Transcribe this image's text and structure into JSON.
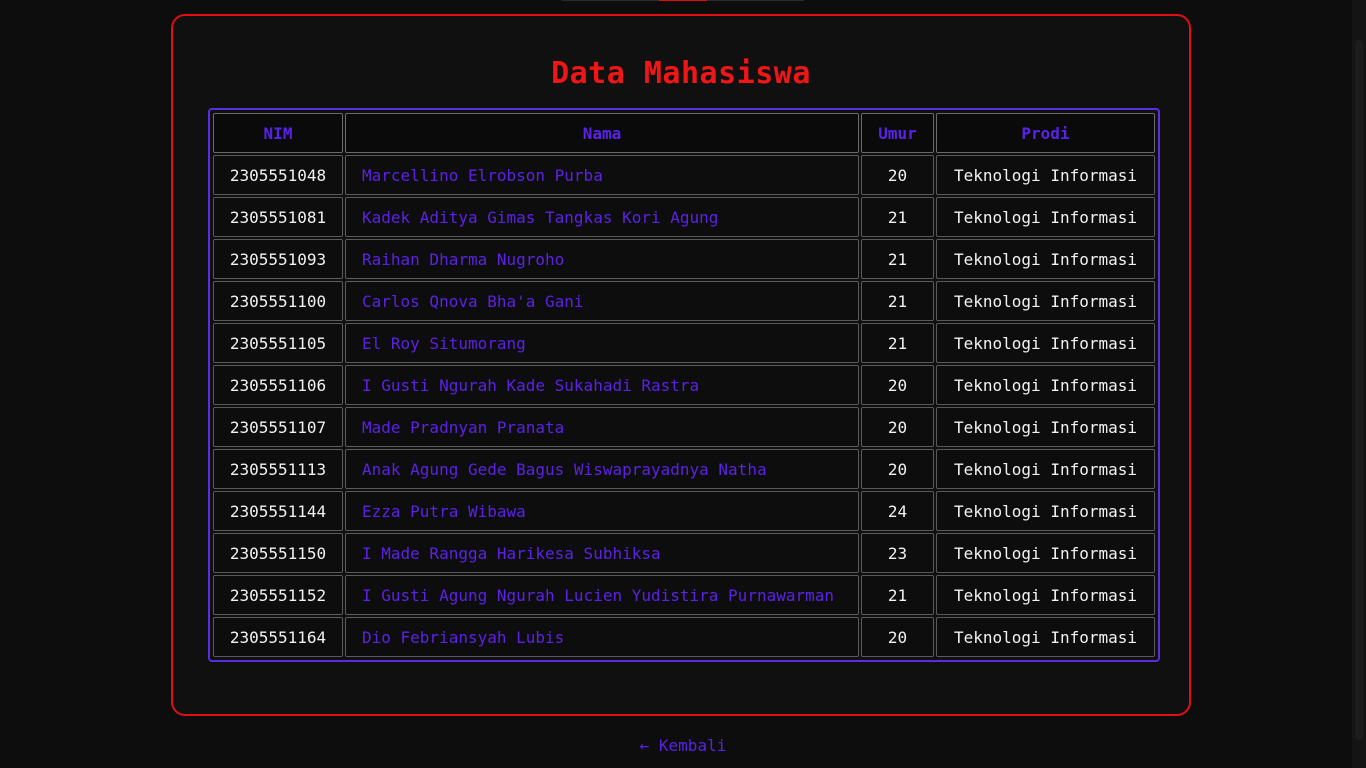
{
  "page": {
    "title": "Data Mahasiswa",
    "back_link": "← Kembali"
  },
  "colors": {
    "accent_red": "#e01010",
    "accent_purple": "#5a22e8",
    "background": "#0d0d0d"
  },
  "table": {
    "headers": [
      "NIM",
      "Nama",
      "Umur",
      "Prodi"
    ],
    "rows": [
      {
        "nim": "2305551048",
        "nama": "Marcellino Elrobson Purba",
        "umur": "20",
        "prodi": "Teknologi Informasi"
      },
      {
        "nim": "2305551081",
        "nama": "Kadek Aditya Gimas Tangkas Kori Agung",
        "umur": "21",
        "prodi": "Teknologi Informasi"
      },
      {
        "nim": "2305551093",
        "nama": "Raihan Dharma Nugroho",
        "umur": "21",
        "prodi": "Teknologi Informasi"
      },
      {
        "nim": "2305551100",
        "nama": "Carlos Qnova Bha'a Gani",
        "umur": "21",
        "prodi": "Teknologi Informasi"
      },
      {
        "nim": "2305551105",
        "nama": "El Roy Situmorang",
        "umur": "21",
        "prodi": "Teknologi Informasi"
      },
      {
        "nim": "2305551106",
        "nama": "I Gusti Ngurah Kade Sukahadi Rastra",
        "umur": "20",
        "prodi": "Teknologi Informasi"
      },
      {
        "nim": "2305551107",
        "nama": "Made Pradnyan Pranata",
        "umur": "20",
        "prodi": "Teknologi Informasi"
      },
      {
        "nim": "2305551113",
        "nama": "Anak Agung Gede Bagus Wiswaprayadnya Natha",
        "umur": "20",
        "prodi": "Teknologi Informasi"
      },
      {
        "nim": "2305551144",
        "nama": "Ezza Putra Wibawa",
        "umur": "24",
        "prodi": "Teknologi Informasi"
      },
      {
        "nim": "2305551150",
        "nama": "I Made Rangga Harikesa Subhiksa",
        "umur": "23",
        "prodi": "Teknologi Informasi"
      },
      {
        "nim": "2305551152",
        "nama": "I Gusti Agung Ngurah Lucien Yudistira Purnawarman",
        "umur": "21",
        "prodi": "Teknologi Informasi"
      },
      {
        "nim": "2305551164",
        "nama": "Dio Febriansyah Lubis",
        "umur": "20",
        "prodi": "Teknologi Informasi"
      }
    ]
  }
}
